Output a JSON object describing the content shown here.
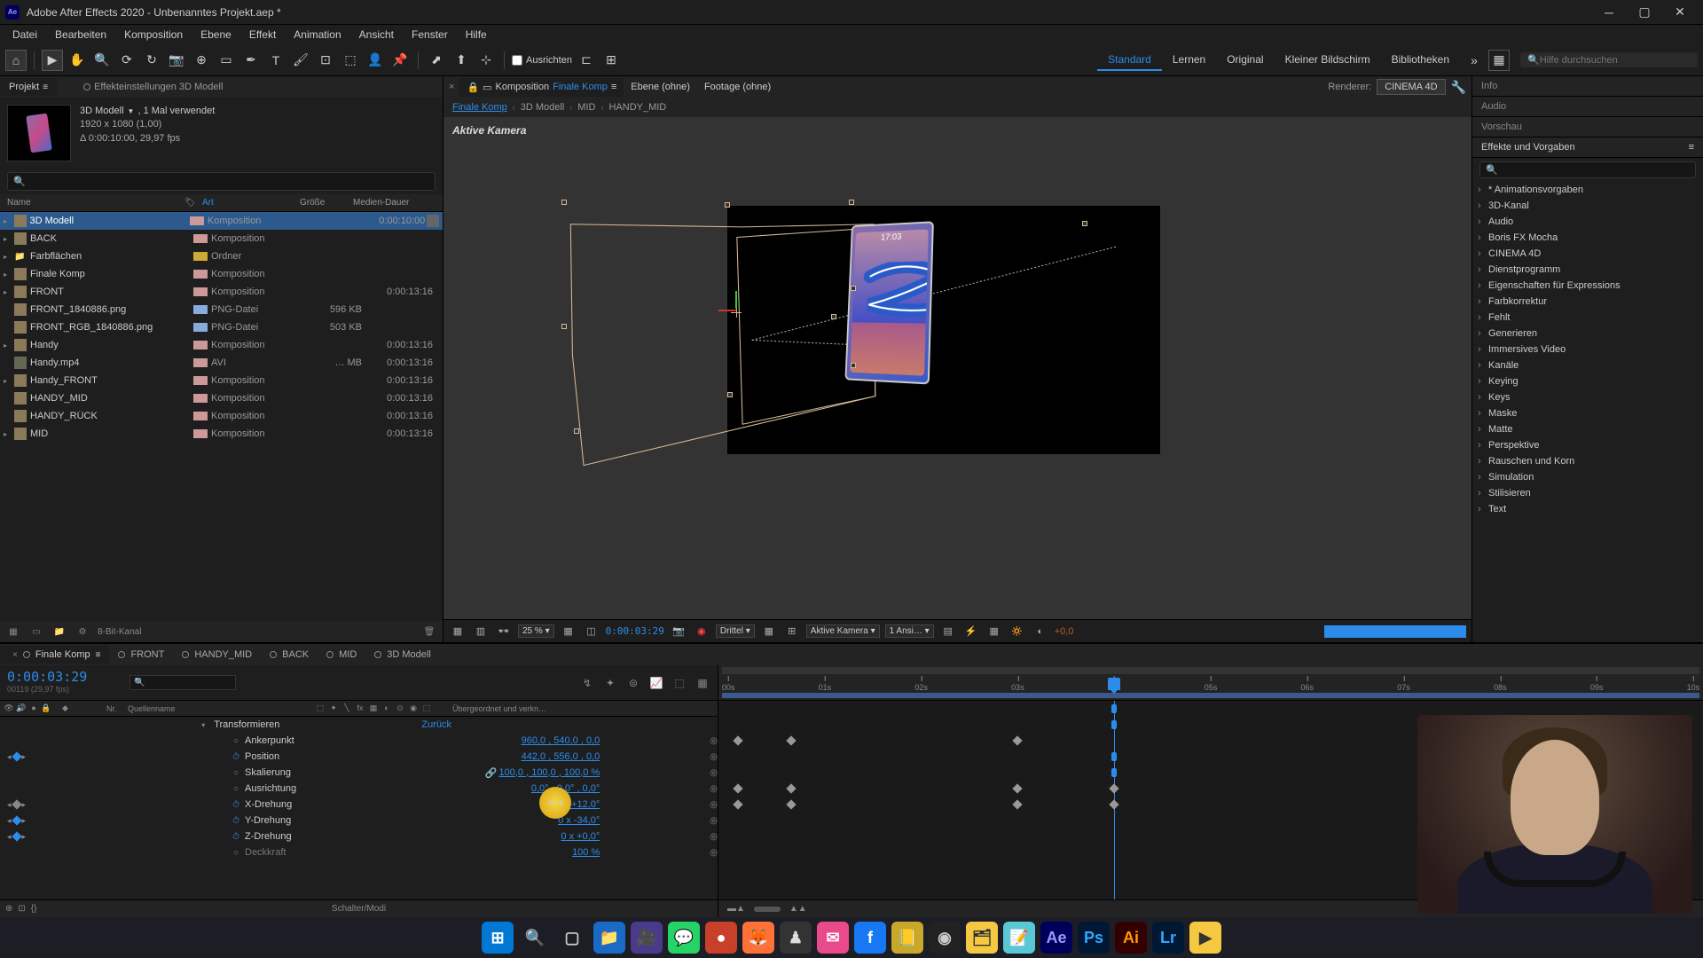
{
  "window": {
    "title": "Adobe After Effects 2020 - Unbenanntes Projekt.aep *",
    "app_icon": "Ae"
  },
  "menu": [
    "Datei",
    "Bearbeiten",
    "Komposition",
    "Ebene",
    "Effekt",
    "Animation",
    "Ansicht",
    "Fenster",
    "Hilfe"
  ],
  "toolbar": {
    "align_label": "Ausrichten",
    "workspaces": [
      "Standard",
      "Lernen",
      "Original",
      "Kleiner Bildschirm",
      "Bibliotheken"
    ],
    "active_workspace": "Standard",
    "search_placeholder": "Hilfe durchsuchen"
  },
  "project": {
    "panel_title": "Projekt",
    "effect_controls_label": "Effekteinstellungen 3D Modell",
    "selected_name": "3D Modell",
    "used": ", 1 Mal verwendet",
    "resolution": "1920 x 1080 (1,00)",
    "dur_fps": "Δ 0:00:10:00, 29,97 fps",
    "footer_depth": "8-Bit-Kanal",
    "cols": {
      "name": "Name",
      "art": "Art",
      "groesse": "Größe",
      "dauer": "Medien-Dauer"
    },
    "items": [
      {
        "name": "3D Modell",
        "type": "Komposition",
        "size": "",
        "dur": "0:00:10:00",
        "tag": "#c99",
        "selected": true,
        "twirl": true,
        "end": true
      },
      {
        "name": "BACK",
        "type": "Komposition",
        "size": "",
        "dur": "",
        "tag": "#c99",
        "twirl": true
      },
      {
        "name": "Farbflächen",
        "type": "Ordner",
        "size": "",
        "dur": "",
        "tag": "#ca3",
        "folder": true,
        "twirl": true
      },
      {
        "name": "Finale Komp",
        "type": "Komposition",
        "size": "",
        "dur": "",
        "tag": "#c99",
        "twirl": true
      },
      {
        "name": "FRONT",
        "type": "Komposition",
        "size": "",
        "dur": "0:00:13:16",
        "tag": "#c99",
        "twirl": true
      },
      {
        "name": "FRONT_1840886.png",
        "type": "PNG-Datei",
        "size": "596 KB",
        "dur": "",
        "tag": "#8ad"
      },
      {
        "name": "FRONT_RGB_1840886.png",
        "type": "PNG-Datei",
        "size": "503 KB",
        "dur": "",
        "tag": "#8ad"
      },
      {
        "name": "Handy",
        "type": "Komposition",
        "size": "",
        "dur": "0:00:13:16",
        "tag": "#c99",
        "twirl": true
      },
      {
        "name": "Handy.mp4",
        "type": "AVI",
        "size": "… MB",
        "dur": "0:00:13:16",
        "tag": "#c99",
        "video": true
      },
      {
        "name": "Handy_FRONT",
        "type": "Komposition",
        "size": "",
        "dur": "0:00:13:16",
        "tag": "#c99",
        "twirl": true
      },
      {
        "name": "HANDY_MID",
        "type": "Komposition",
        "size": "",
        "dur": "0:00:13:16",
        "tag": "#c99"
      },
      {
        "name": "HANDY_RÜCK",
        "type": "Komposition",
        "size": "",
        "dur": "0:00:13:16",
        "tag": "#c99"
      },
      {
        "name": "MID",
        "type": "Komposition",
        "size": "",
        "dur": "0:00:13:16",
        "tag": "#c99",
        "twirl": true
      }
    ]
  },
  "viewer": {
    "tabs": {
      "comp_prefix": "Komposition",
      "comp_name": "Finale Komp",
      "layer": "Ebene  (ohne)",
      "footage": "Footage  (ohne)"
    },
    "renderer_label": "Renderer:",
    "renderer": "CINEMA 4D",
    "crumbs": [
      "Finale Komp",
      "3D Modell",
      "MID",
      "HANDY_MID"
    ],
    "active_cam": "Aktive Kamera",
    "phone_time": "17:03",
    "controls": {
      "zoom": "25 %",
      "time": "0:00:03:29",
      "res": "Drittel",
      "cam": "Aktive Kamera",
      "views": "1 Ansi…",
      "exposure": "+0,0"
    }
  },
  "right": {
    "info": "Info",
    "audio": "Audio",
    "preview": "Vorschau",
    "effects_title": "Effekte und Vorgaben",
    "categories": [
      "* Animationsvorgaben",
      "3D-Kanal",
      "Audio",
      "Boris FX Mocha",
      "CINEMA 4D",
      "Dienstprogramm",
      "Eigenschaften für Expressions",
      "Farbkorrektur",
      "Fehlt",
      "Generieren",
      "Immersives Video",
      "Kanäle",
      "Keying",
      "Keys",
      "Maske",
      "Matte",
      "Perspektive",
      "Rauschen und Korn",
      "Simulation",
      "Stilisieren",
      "Text"
    ]
  },
  "timeline": {
    "tabs": [
      "Finale Komp",
      "FRONT",
      "HANDY_MID",
      "BACK",
      "MID",
      "3D Modell"
    ],
    "active_tab": "Finale Komp",
    "timecode": "0:00:03:29",
    "frames_label": "00119 (29,97 fps)",
    "col_nr": "Nr.",
    "col_name": "Quellenname",
    "col_parent": "Übergeordnet und verkn…",
    "footer": "Schalter/Modi",
    "group": "Transformieren",
    "reset": "Zurück",
    "props": [
      {
        "name": "Ankerpunkt",
        "val": "960,0 , 540,0 , 0,0",
        "kf": false
      },
      {
        "name": "Position",
        "val": "442,0 , 556,0 , 0,0",
        "kf": true,
        "stopwatch": true
      },
      {
        "name": "Skalierung",
        "val": "100,0 , 100,0 , 100,0 %",
        "kf": false,
        "link": true
      },
      {
        "name": "Ausrichtung",
        "val": "0,0° , 0,0° , 0,0°",
        "kf": false
      },
      {
        "name": "X-Drehung",
        "val": "0 x +12,0°",
        "kf": true,
        "stopwatch": true,
        "highlight": true
      },
      {
        "name": "Y-Drehung",
        "val": "0 x -34,0°",
        "kf": true,
        "stopwatch": true
      },
      {
        "name": "Z-Drehung",
        "val": "0 x +0,0°",
        "kf": true,
        "stopwatch": true
      },
      {
        "name": "Deckkraft",
        "val": "100 %",
        "kf": false,
        "dim": true
      }
    ],
    "ruler": [
      "00s",
      "01s",
      "02s",
      "03s",
      "04s",
      "05s",
      "06s",
      "07s",
      "08s",
      "09s",
      "10s"
    ],
    "playhead_pct": 40,
    "kf_rows": {
      "Position": [
        1,
        6.5,
        30
      ],
      "X-Drehung": [
        1,
        6.5,
        30,
        40
      ],
      "Y-Drehung": [
        1,
        6.5,
        30,
        40
      ],
      "Z-Drehung": []
    },
    "markers": [
      40
    ]
  },
  "taskbar": [
    {
      "label": "⊞",
      "bg": "#0078d4",
      "fg": "#fff"
    },
    {
      "label": "🔍",
      "bg": "transparent",
      "fg": "#ccc"
    },
    {
      "label": "▢",
      "bg": "transparent",
      "fg": "#ccc"
    },
    {
      "label": "📁",
      "bg": "#1a6ac8",
      "fg": "#fff"
    },
    {
      "label": "🎥",
      "bg": "#4a3a8a",
      "fg": "#fff"
    },
    {
      "label": "💬",
      "bg": "#25d366",
      "fg": "#fff"
    },
    {
      "label": "●",
      "bg": "#c8402a",
      "fg": "#fff"
    },
    {
      "label": "🦊",
      "bg": "#ff7139",
      "fg": "#fff"
    },
    {
      "label": "♟",
      "bg": "#333",
      "fg": "#ddd"
    },
    {
      "label": "✉",
      "bg": "#e84a8a",
      "fg": "#fff"
    },
    {
      "label": "f",
      "bg": "#1877f2",
      "fg": "#fff"
    },
    {
      "label": "📒",
      "bg": "#c8a82a",
      "fg": "#fff"
    },
    {
      "label": "◉",
      "bg": "#222",
      "fg": "#ccc"
    },
    {
      "label": "🗂",
      "bg": "#f5c842",
      "fg": "#333"
    },
    {
      "label": "📝",
      "bg": "#5ac8d4",
      "fg": "#fff"
    },
    {
      "label": "Ae",
      "bg": "#00005b",
      "fg": "#9999ff"
    },
    {
      "label": "Ps",
      "bg": "#001833",
      "fg": "#31a8ff"
    },
    {
      "label": "Ai",
      "bg": "#330000",
      "fg": "#ff9a00"
    },
    {
      "label": "Lr",
      "bg": "#001833",
      "fg": "#31a8ff"
    },
    {
      "label": "▶",
      "bg": "#f5c842",
      "fg": "#333"
    }
  ]
}
